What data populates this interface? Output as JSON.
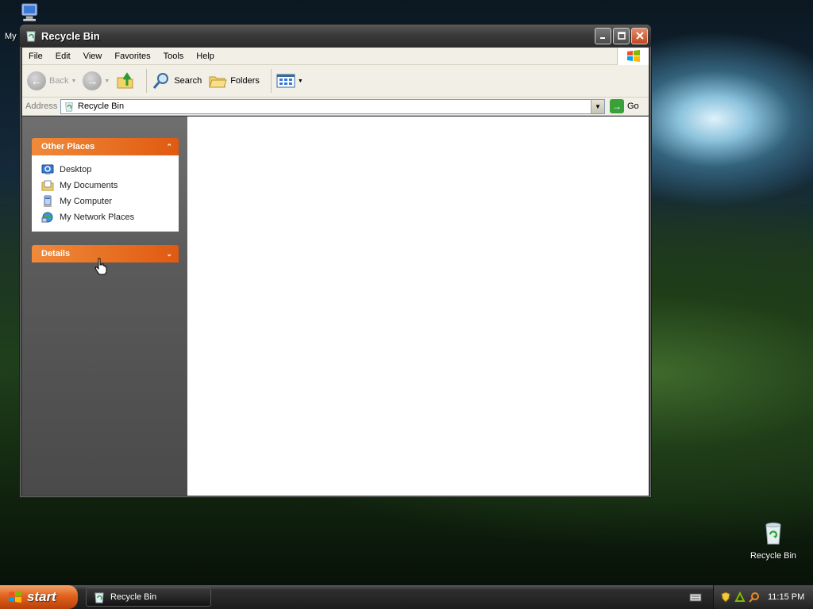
{
  "desktop": {
    "top_left_icon_label": "My",
    "recycle_bin_label": "Recycle Bin"
  },
  "window": {
    "title": "Recycle Bin",
    "menu": [
      "File",
      "Edit",
      "View",
      "Favorites",
      "Tools",
      "Help"
    ],
    "toolbar": {
      "back_label": "Back",
      "search_label": "Search",
      "folders_label": "Folders"
    },
    "address": {
      "label": "Address",
      "value": "Recycle Bin",
      "go_label": "Go"
    },
    "taskpane": {
      "other_places": {
        "title": "Other Places",
        "items": [
          "Desktop",
          "My Documents",
          "My Computer",
          "My Network Places"
        ]
      },
      "details": {
        "title": "Details"
      }
    }
  },
  "taskbar": {
    "start_label": "start",
    "task_label": "Recycle Bin",
    "clock": "11:15 PM"
  },
  "colors": {
    "panel_header": "#e05a10",
    "taskbar": "#1c1c1c",
    "start_button": "#e2621c"
  }
}
